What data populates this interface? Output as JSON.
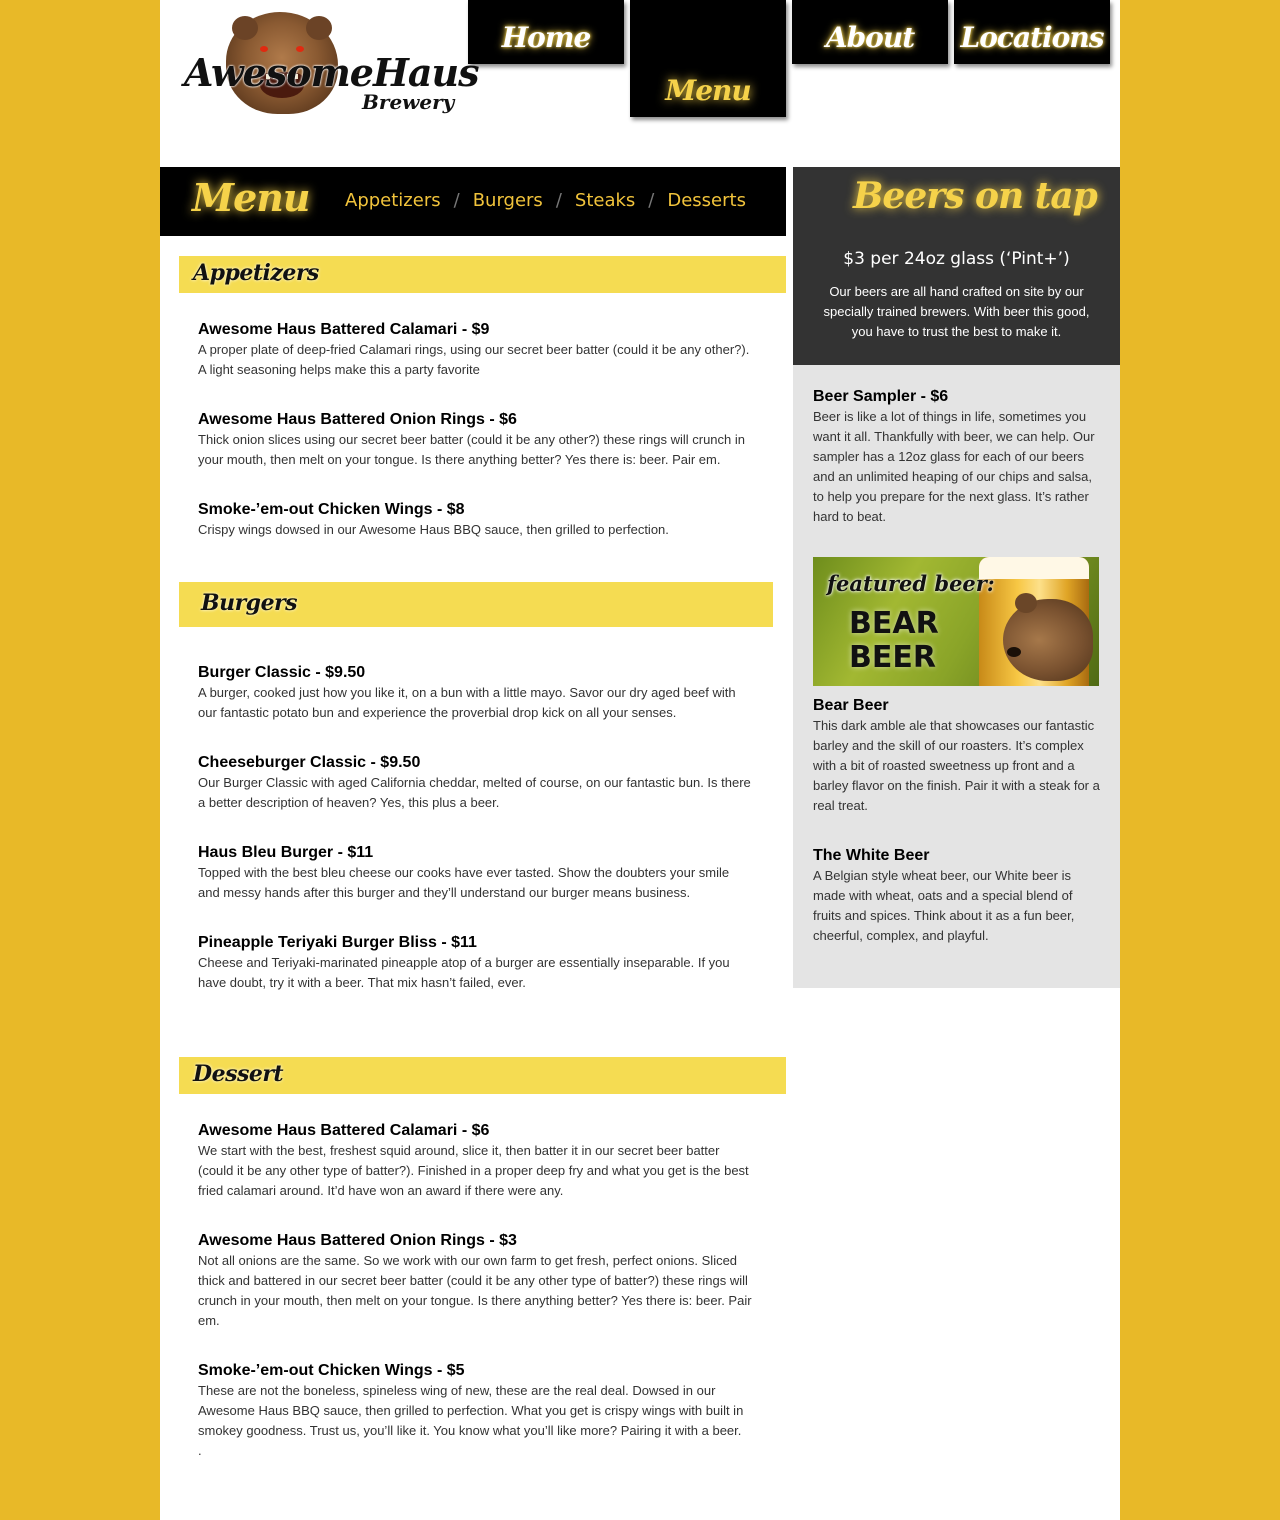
{
  "brand": {
    "logo_text": "AwesomeHaus",
    "logo_sub": "Brewery"
  },
  "nav": {
    "home": "Home",
    "menu": "Menu",
    "about": "About",
    "locations": "Locations",
    "active": "Menu"
  },
  "menu_bar": {
    "title": "Menu",
    "links": [
      "Appetizers",
      "Burgers",
      "Steaks",
      "Desserts"
    ],
    "separator": "/"
  },
  "sections": {
    "appetizers": {
      "title": "Appetizers",
      "items": [
        {
          "name": "Awesome Haus Battered Calamari - $9",
          "desc": "A proper plate of deep-fried Calamari rings, using our secret beer batter (could it be any other?). A light seasoning helps make this a party favorite"
        },
        {
          "name": "Awesome Haus Battered Onion Rings - $6",
          "desc": "Thick onion slices using our secret beer batter (could it be any other?) these rings will crunch in your mouth, then melt on your tongue. Is there anything better? Yes there is: beer. Pair em."
        },
        {
          "name": "Smoke-’em-out Chicken Wings - $8",
          "desc": "Crispy wings dowsed in our Awesome Haus BBQ sauce, then grilled to perfection."
        }
      ]
    },
    "burgers": {
      "title": "Burgers",
      "items": [
        {
          "name": "Burger Classic - $9.50",
          "desc": "A burger, cooked just how you like it, on a bun with a little mayo. Savor our dry aged beef with our fantastic potato bun and experience the proverbial drop kick on all your senses."
        },
        {
          "name": "Cheeseburger Classic - $9.50",
          "desc": "Our Burger Classic with aged California cheddar, melted of course, on our fantastic bun. Is there a better description of heaven? Yes, this plus a beer."
        },
        {
          "name": "Haus Bleu Burger - $11",
          "desc": "Topped with the best bleu cheese our cooks have ever tasted. Show the doubters your smile and messy hands after this burger and they’ll understand our burger means business."
        },
        {
          "name": "Pineapple Teriyaki Burger Bliss - $11",
          "desc": "Cheese and Teriyaki-marinated pineapple atop of a burger are essentially inseparable. If you have doubt, try it with a beer. That mix hasn’t failed, ever."
        }
      ]
    },
    "dessert": {
      "title": "Dessert",
      "items": [
        {
          "name": "Awesome Haus Battered Calamari - $6",
          "desc": "We start with the best, freshest squid around, slice it, then batter it in our secret beer batter (could it be any other type of batter?). Finished in a proper deep fry and what you get is the best fried calamari around. It’d have won an award if there were any."
        },
        {
          "name": "Awesome Haus Battered Onion Rings - $3",
          "desc": "Not all onions are the same. So we work with our own farm to get fresh, perfect onions. Sliced thick and battered in our secret beer batter (could it be any other type of batter?) these rings will crunch in your mouth, then melt on your tongue. Is there anything better? Yes there is: beer. Pair em."
        },
        {
          "name": "Smoke-’em-out Chicken Wings - $5",
          "desc": "These are not the boneless, spineless wing of new, these are the real deal. Dowsed in our Awesome Haus BBQ sauce, then grilled to perfection. What you get is crispy wings with built in smokey goodness. Trust us, you’ll like it. You know what you’ll like more? Pairing it with a beer.",
          "trailing": "."
        }
      ]
    }
  },
  "sidebar": {
    "title": "Beers on tap",
    "price": "$3 per 24oz glass (‘Pint+’)",
    "intro": "Our beers are all hand crafted on site by our specially trained brewers. With beer this good, you have to trust the best to make it.",
    "sampler": {
      "name": "Beer Sampler - $6",
      "desc": "Beer is like a lot of things in life, sometimes you want it all. Thankfully with beer, we can help. Our sampler has a 12oz glass for each of our beers and an unlimited heaping of our chips and salsa, to help you prepare for the next glass. It’s rather hard to beat."
    },
    "featured": {
      "label": "featured beer:",
      "name": "BEAR BEER"
    },
    "beers": [
      {
        "name": "Bear Beer",
        "desc": "This dark amble ale that showcases our fantastic barley and the skill of our roasters. It’s complex with a bit of roasted sweetness up front and a barley flavor on the finish. Pair it with a steak for a real treat."
      },
      {
        "name": "The White Beer",
        "desc": "A Belgian style wheat beer, our White beer is made with wheat, oats and a special blend of fruits and spices. Think about it as a fun beer, cheerful, complex, and playful."
      }
    ]
  },
  "colors": {
    "background": "#e8b928",
    "accent_yellow": "#f5d24a",
    "section_header": "#f5dc52",
    "nav_black": "#000000",
    "sidebar_dark": "#333333",
    "sidebar_light": "#e4e4e4"
  }
}
